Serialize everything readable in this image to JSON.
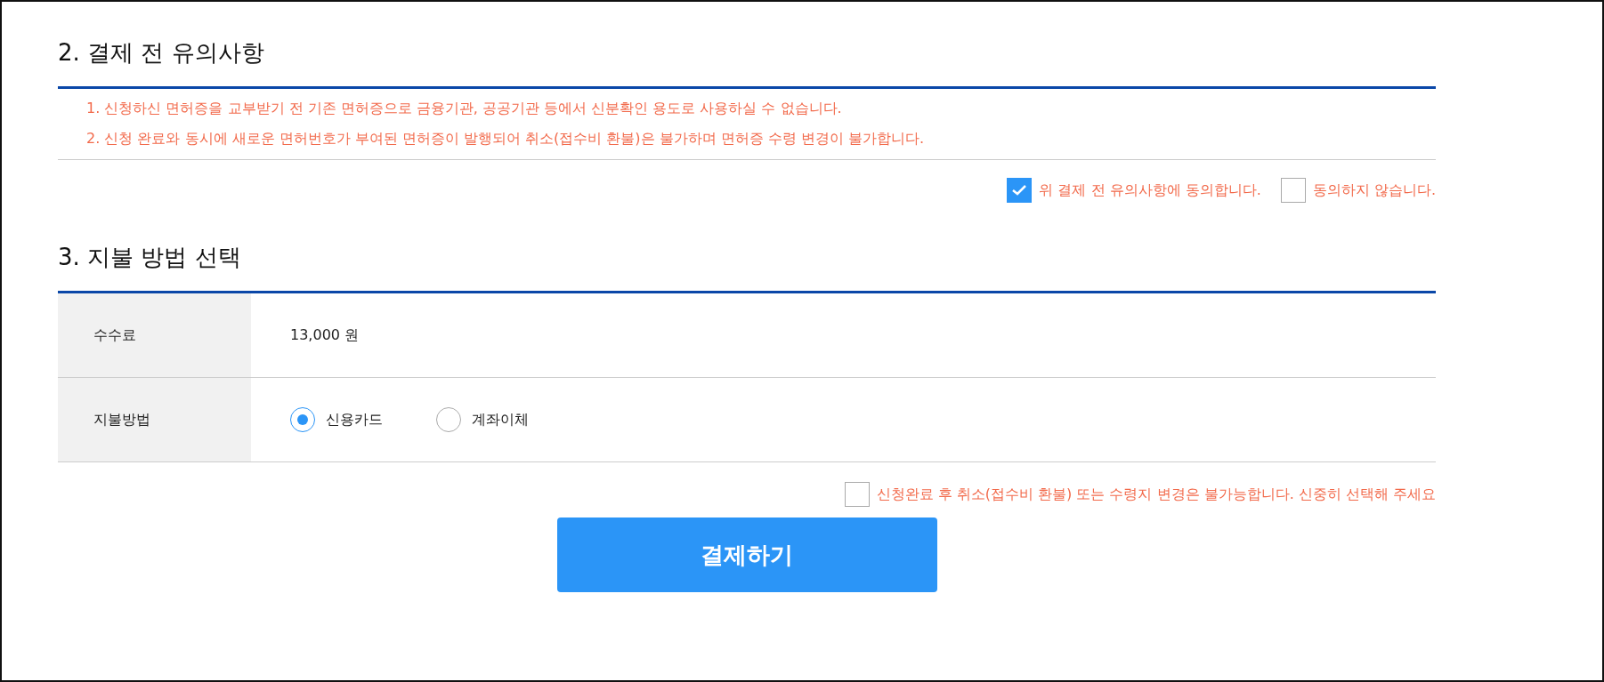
{
  "notice_section": {
    "title": "2. 결제 전 유의사항",
    "notes": [
      "1. 신청하신 면허증을 교부받기 전 기존 면허증으로 금융기관, 공공기관 등에서 신분확인 용도로 사용하실 수 없습니다.",
      "2. 신청 완료와 동시에 새로운 면허번호가 부여된 면허증이 발행되어 취소(접수비 환불)은 불가하며 면허증 수령 변경이 불가합니다."
    ],
    "consent_options": [
      {
        "label": "위 결제 전 유의사항에 동의합니다.",
        "checked": true
      },
      {
        "label": "동의하지 않습니다.",
        "checked": false
      }
    ]
  },
  "payment_section": {
    "title": "3. 지불 방법 선택",
    "fee_label": "수수료",
    "fee_value": "13,000 원",
    "method_label": "지불방법",
    "methods": [
      {
        "label": "신용카드",
        "selected": true
      },
      {
        "label": "계좌이체",
        "selected": false
      }
    ],
    "confirm": {
      "label": "신청완료 후 취소(접수비 환불) 또는 수령지 변경은 불가능합니다. 신중히 선택해 주세요",
      "checked": false
    },
    "pay_button": "결제하기"
  }
}
